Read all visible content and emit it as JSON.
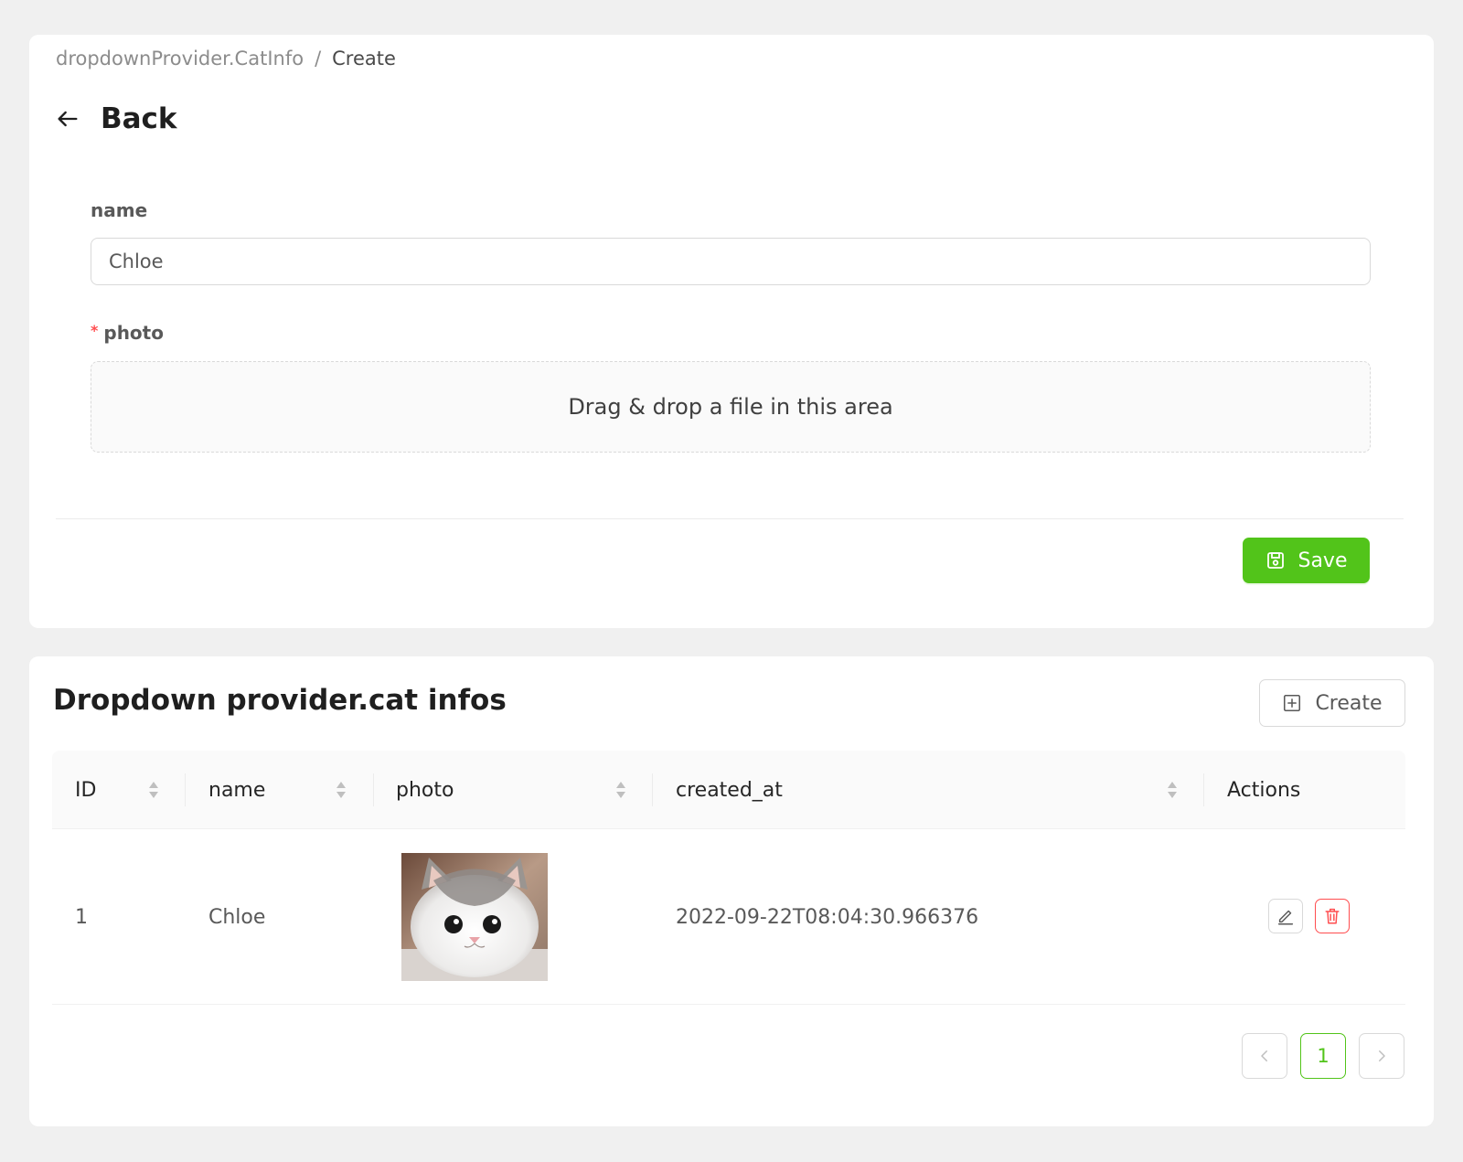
{
  "breadcrumb": {
    "parent": "dropdownProvider.CatInfo",
    "separator": "/",
    "current": "Create"
  },
  "header": {
    "back_label": "Back"
  },
  "form": {
    "name_label": "name",
    "name_value": "Chloe",
    "photo_required_mark": "*",
    "photo_label": "photo",
    "dropzone_text": "Drag & drop a file in this area",
    "save_label": "Save"
  },
  "list": {
    "title": "Dropdown provider.cat infos",
    "create_label": "Create",
    "columns": [
      "ID",
      "name",
      "photo",
      "created_at",
      "Actions"
    ],
    "rows": [
      {
        "id": "1",
        "name": "Chloe",
        "created_at": "2022-09-22T08:04:30.966376"
      }
    ],
    "pagination": {
      "current_page": "1"
    }
  },
  "colors": {
    "primary": "#52c41a",
    "danger": "#ff4d4f",
    "required": "#ff4d4f"
  },
  "icons": [
    "arrow-left-icon",
    "save-icon",
    "plus-square-icon",
    "sort-icon",
    "edit-icon",
    "delete-icon",
    "chevron-left-icon",
    "chevron-right-icon"
  ]
}
